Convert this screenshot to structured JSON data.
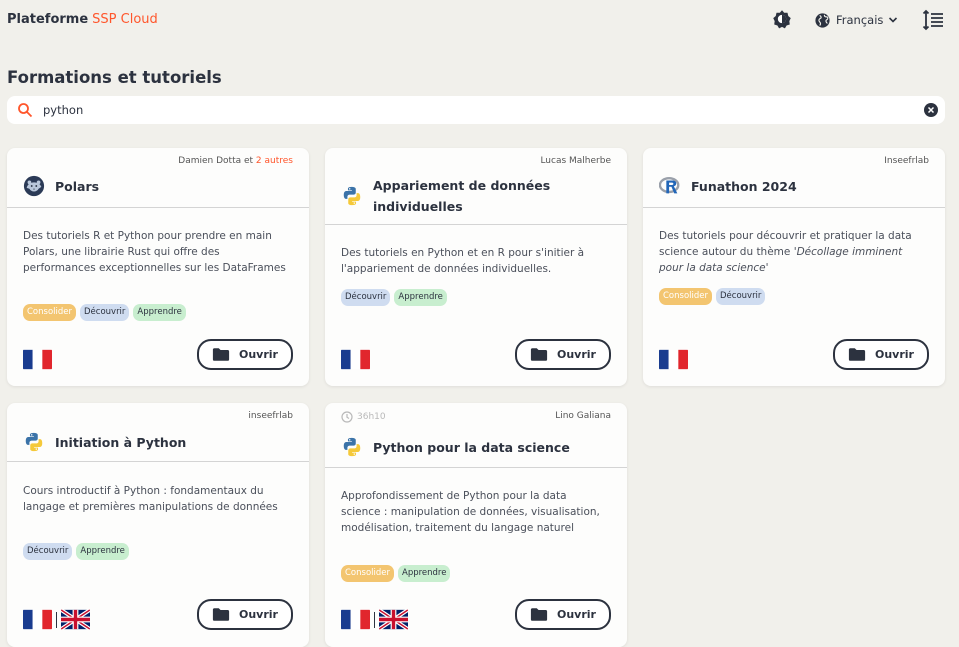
{
  "header": {
    "brand_main": "Plateforme",
    "brand_accent": "SSP Cloud",
    "theme_icon": "theme-toggle-icon",
    "language": "Français",
    "globe_icon": "globe-icon",
    "menu_icon": "sort-lines-icon"
  },
  "page": {
    "title": "Formations et tutoriels"
  },
  "search": {
    "value": "python",
    "search_icon": "search-icon",
    "clear_icon": "clear-icon"
  },
  "colors": {
    "accent": "#ff562c",
    "background": "#f1f0eb",
    "consolider": "#f3c570",
    "decouvrir": "#cfdcf0",
    "apprendre": "#c8eecf"
  },
  "cards": [
    {
      "author": "Damien Dotta et ",
      "author_others": "2 autres",
      "logo": "polars-bear-logo",
      "title": "Polars",
      "description": "Des tutoriels R et Python pour prendre en main Polars, une librairie Rust qui offre des performances exceptionnelles sur les DataFrames",
      "tags": [
        "Consolider",
        "Découvrir",
        "Apprendre"
      ],
      "flags": [
        "french-flag"
      ],
      "button": "Ouvrir"
    },
    {
      "author": "Lucas Malherbe",
      "logo": "python-logo",
      "title": "Appariement de données individuelles",
      "description": "Des tutoriels en Python et en R pour s'initier à l'appariement de données individuelles.",
      "tags": [
        "Découvrir",
        "Apprendre"
      ],
      "flags": [
        "french-flag"
      ],
      "button": "Ouvrir"
    },
    {
      "author": "Inseefrlab",
      "logo": "r-logo",
      "title": "Funathon 2024",
      "description": "Des tutoriels pour découvrir et pratiquer la data science autour du thème ",
      "description_italic": "'Décollage imminent pour la data science'",
      "tags": [
        "Consolider",
        "Découvrir"
      ],
      "flags": [
        "french-flag"
      ],
      "button": "Ouvrir"
    },
    {
      "author": "inseefrlab",
      "logo": "python-logo",
      "title": "Initiation à Python",
      "description": "Cours introductif à Python : fondamentaux du langage et premières manipulations de données",
      "tags": [
        "Découvrir",
        "Apprendre"
      ],
      "flags": [
        "french-flag",
        "uk-flag"
      ],
      "button": "Ouvrir"
    },
    {
      "duration": "36h10",
      "duration_icon": "clock-icon",
      "author": "Lino Galiana",
      "logo": "python-logo",
      "title": "Python pour la data science",
      "description": "Approfondissement de Python pour la data science : manipulation de données, visualisation, modélisation, traitement du langage naturel",
      "tags": [
        "Consolider",
        "Apprendre"
      ],
      "flags": [
        "french-flag",
        "uk-flag"
      ],
      "button": "Ouvrir"
    }
  ]
}
